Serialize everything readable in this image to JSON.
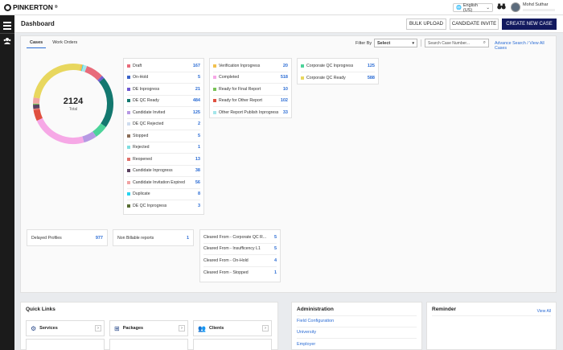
{
  "topbar": {
    "logo_text": "PINKERTON",
    "logo_reg": "®",
    "language": "English (US)",
    "language_caret": "⌄",
    "user_name": "Mohd Suthar"
  },
  "header": {
    "title": "Dashboard",
    "bulk_upload": "BULK UPLOAD",
    "candidate_invite": "CANDIDATE INVITE",
    "create_case": "CREATE NEW CASE"
  },
  "main": {
    "tabs": [
      "Cases",
      "Work Orders"
    ],
    "filter_label": "Filter By",
    "filter_value": "Select",
    "search_placeholder": "Search Case Number...",
    "advance_search": "Advance Search / View All Cases"
  },
  "donut": {
    "total": "2124",
    "total_label": "Total"
  },
  "status_col1": [
    {
      "label": "Draft",
      "value": "167",
      "color": "#e86b7a"
    },
    {
      "label": "On-Hold",
      "value": "5",
      "color": "#3a63c8"
    },
    {
      "label": "DE Inprogress",
      "value": "21",
      "color": "#6f5ad0"
    },
    {
      "label": "DE QC Ready",
      "value": "484",
      "color": "#13786f"
    },
    {
      "label": "Candidate Invited",
      "value": "125",
      "color": "#b699e3"
    },
    {
      "label": "DE QC Rejected",
      "value": "2",
      "color": "#cfdcef"
    },
    {
      "label": "Stopped",
      "value": "5",
      "color": "#8a6e58"
    },
    {
      "label": "Rejected",
      "value": "1",
      "color": "#7edde0"
    },
    {
      "label": "Reopened",
      "value": "13",
      "color": "#e0716c"
    },
    {
      "label": "Candidate Inprogress",
      "value": "38",
      "color": "#5a4260"
    },
    {
      "label": "Candidate Invitation Expired",
      "value": "56",
      "color": "#f1a3a3"
    },
    {
      "label": "Duplicate",
      "value": "8",
      "color": "#27d3f0"
    },
    {
      "label": "DE QC Inprogress",
      "value": "3",
      "color": "#586e34"
    }
  ],
  "status_col2": [
    {
      "label": "Verification Inprogress",
      "value": "20",
      "color": "#f2c14e"
    },
    {
      "label": "Completed",
      "value": "518",
      "color": "#f6a8e6"
    },
    {
      "label": "Ready for Final Report",
      "value": "10",
      "color": "#78c257"
    },
    {
      "label": "Ready for Other Report",
      "value": "102",
      "color": "#e0503f"
    },
    {
      "label": "Other Report Publish Inprogress",
      "value": "33",
      "color": "#a5e6ea"
    }
  ],
  "status_col3": [
    {
      "label": "Corporate QC Inprogress",
      "value": "125",
      "color": "#4cd39a"
    },
    {
      "label": "Corporate QC Ready",
      "value": "588",
      "color": "#e8d75e"
    }
  ],
  "misc": {
    "delayed_label": "Delayed Profiles",
    "delayed_value": "977",
    "nonbill_label": "Non Billable reports",
    "nonbill_value": "1",
    "cleared": [
      {
        "label": "Cleared From - Corporate QC R...",
        "value": "5"
      },
      {
        "label": "Cleared From - Insufficency L1",
        "value": "5"
      },
      {
        "label": "Cleared From - On-Hold",
        "value": "4"
      },
      {
        "label": "Cleared From - Stopped",
        "value": "1"
      }
    ]
  },
  "quick_links": {
    "title": "Quick Links",
    "items": [
      {
        "label": "Services",
        "icon": "services-icon"
      },
      {
        "label": "Packages",
        "icon": "packages-icon"
      },
      {
        "label": "Clients",
        "icon": "clients-icon"
      }
    ],
    "arrow": "›"
  },
  "administration": {
    "title": "Administration",
    "links": [
      "Field Configuration",
      "University",
      "Employer"
    ]
  },
  "reminder": {
    "title": "Reminder",
    "view_all": "View All"
  }
}
